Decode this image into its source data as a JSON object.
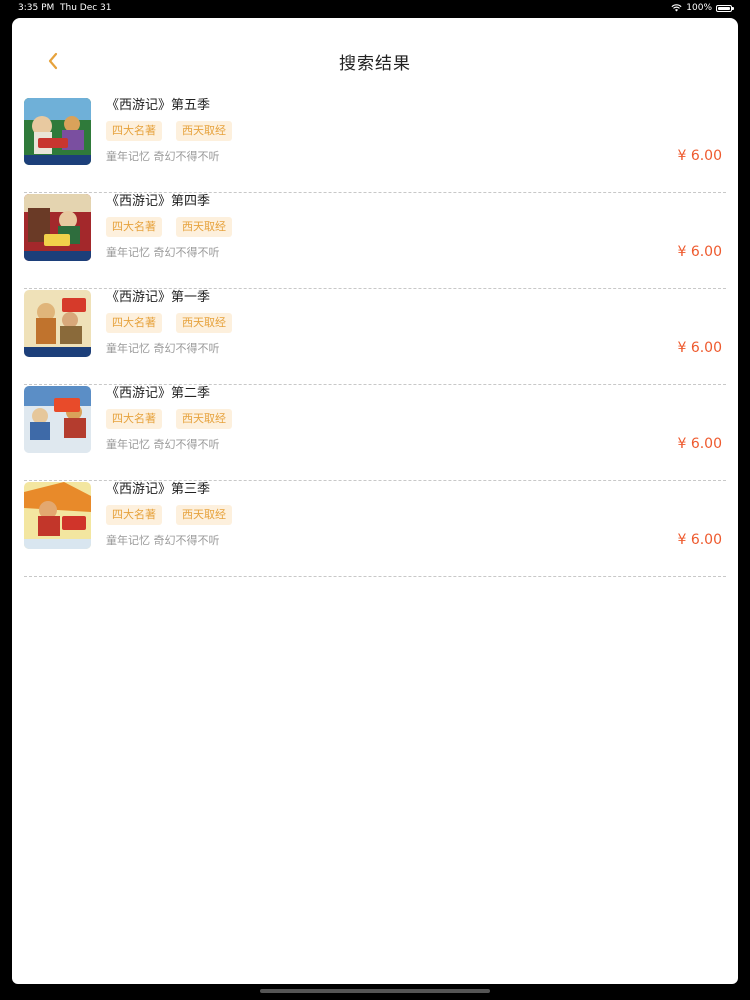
{
  "status_bar": {
    "time": "3:35 PM",
    "date": "Thu Dec 31",
    "battery": "100%"
  },
  "nav": {
    "title": "搜索结果",
    "back_icon": "chevron-left-icon"
  },
  "colors": {
    "accent": "#e6a23c",
    "price": "#ee5a2e",
    "tag_bg": "#fdf0dd"
  },
  "results": [
    {
      "title": "《西游记》第五季",
      "tags": [
        "四大名著",
        "西天取经"
      ],
      "desc": "童年记忆 奇幻不得不听",
      "price": "¥ 6.00"
    },
    {
      "title": "《西游记》第四季",
      "tags": [
        "四大名著",
        "西天取经"
      ],
      "desc": "童年记忆 奇幻不得不听",
      "price": "¥ 6.00"
    },
    {
      "title": "《西游记》第一季",
      "tags": [
        "四大名著",
        "西天取经"
      ],
      "desc": "童年记忆 奇幻不得不听",
      "price": "¥ 6.00"
    },
    {
      "title": "《西游记》第二季",
      "tags": [
        "四大名著",
        "西天取经"
      ],
      "desc": "童年记忆 奇幻不得不听",
      "price": "¥ 6.00"
    },
    {
      "title": "《西游记》第三季",
      "tags": [
        "四大名著",
        "西天取经"
      ],
      "desc": "童年记忆 奇幻不得不听",
      "price": "¥ 6.00"
    }
  ]
}
